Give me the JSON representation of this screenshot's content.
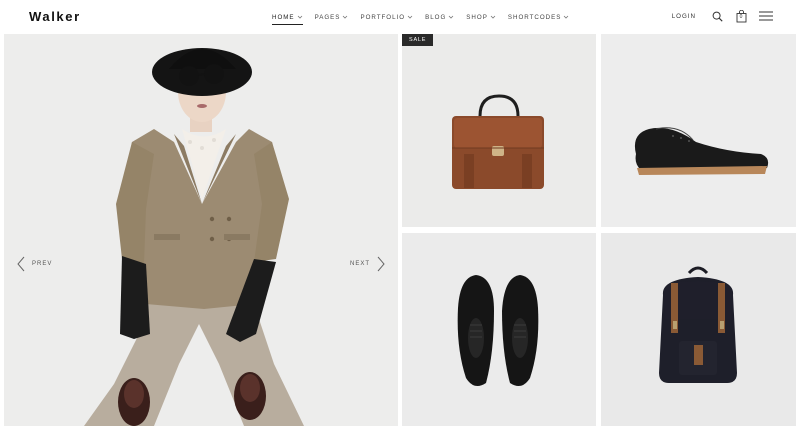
{
  "brand": {
    "logo": "Walker"
  },
  "nav": {
    "items": [
      {
        "label": "HOME",
        "active": true
      },
      {
        "label": "PAGES",
        "active": false
      },
      {
        "label": "PORTFOLIO",
        "active": false
      },
      {
        "label": "BLOG",
        "active": false
      },
      {
        "label": "SHOP",
        "active": false
      },
      {
        "label": "SHORTCODES",
        "active": false
      }
    ]
  },
  "header": {
    "login_label": "LOGIN",
    "cart_count": "0",
    "icons": [
      "search-icon",
      "shopping-bag-icon",
      "hamburger-menu-icon"
    ]
  },
  "hero": {
    "prev_label": "PREV",
    "next_label": "NEXT"
  },
  "products": [
    {
      "badge": "SALE",
      "image": "brown-leather-satchel"
    },
    {
      "badge": "",
      "image": "black-brogue-shoe"
    },
    {
      "badge": "",
      "image": "black-oxford-shoes-pair"
    },
    {
      "badge": "",
      "image": "black-backpack-brown-straps"
    }
  ],
  "colors": {
    "text": "#1a1a1a",
    "badge_bg": "#2a2a2a",
    "tile_bg": "#ececec"
  }
}
